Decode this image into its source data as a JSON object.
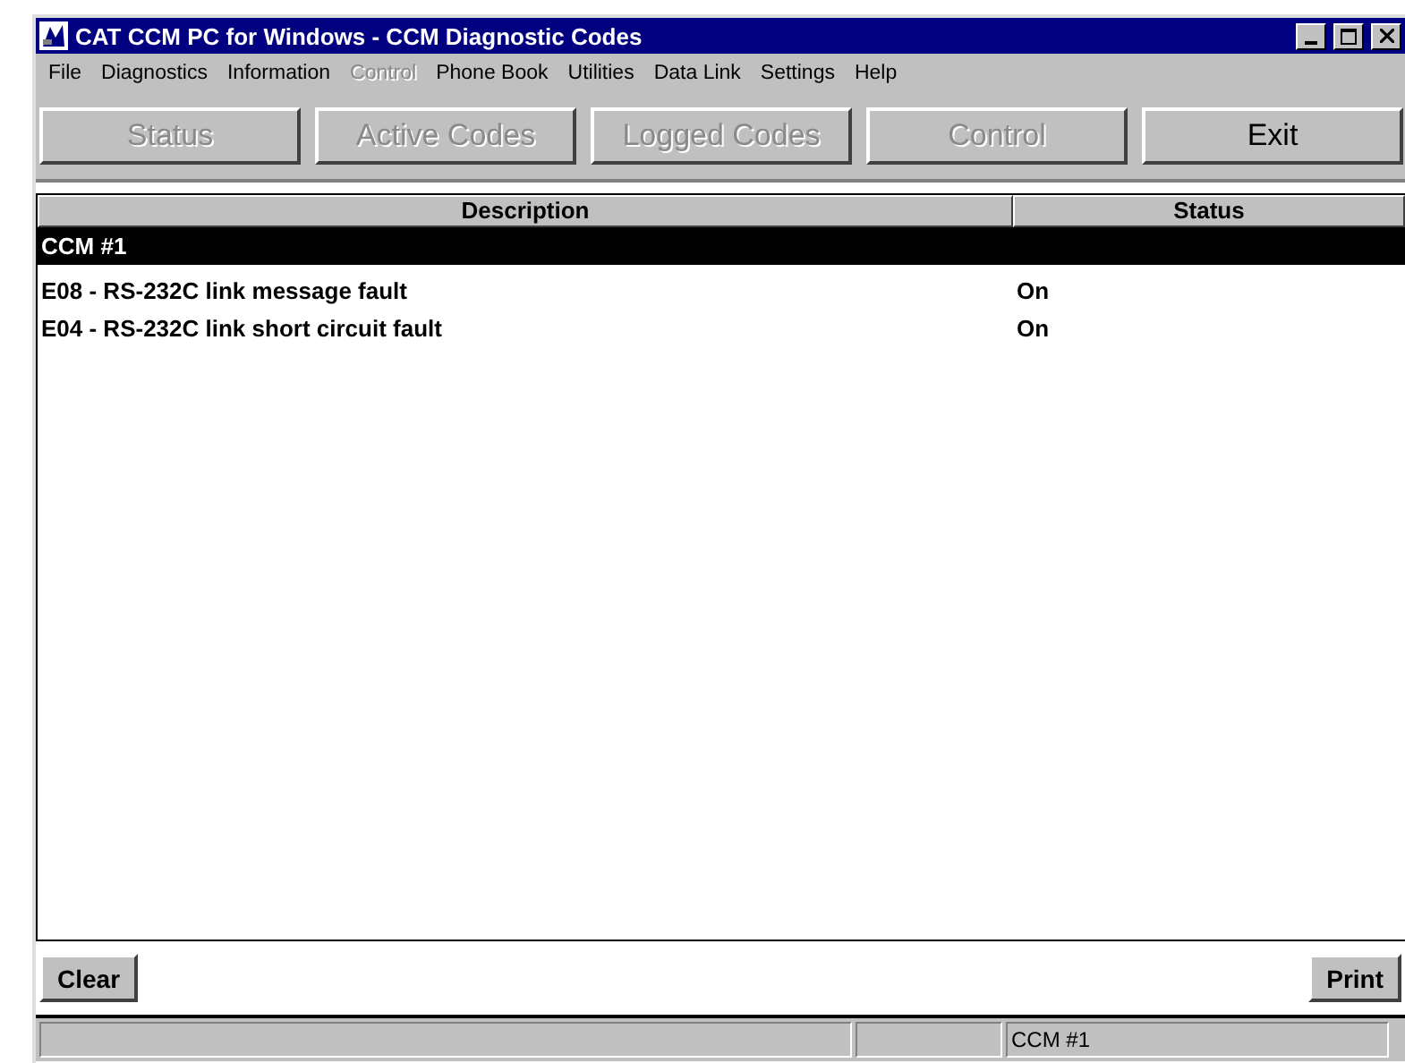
{
  "window": {
    "title": "CAT CCM PC for Windows - CCM Diagnostic Codes"
  },
  "menu": [
    {
      "label": "File",
      "disabled": false
    },
    {
      "label": "Diagnostics",
      "disabled": false
    },
    {
      "label": "Information",
      "disabled": false
    },
    {
      "label": "Control",
      "disabled": true
    },
    {
      "label": "Phone Book",
      "disabled": false
    },
    {
      "label": "Utilities",
      "disabled": false
    },
    {
      "label": "Data Link",
      "disabled": false
    },
    {
      "label": "Settings",
      "disabled": false
    },
    {
      "label": "Help",
      "disabled": false
    }
  ],
  "toolbar": [
    {
      "label": "Status",
      "disabled": true
    },
    {
      "label": "Active Codes",
      "disabled": true
    },
    {
      "label": "Logged Codes",
      "disabled": true
    },
    {
      "label": "Control",
      "disabled": true
    },
    {
      "label": "Exit",
      "disabled": false
    }
  ],
  "table": {
    "columns": [
      "Description",
      "Status"
    ],
    "rows": [
      {
        "description": "CCM #1",
        "selected": true
      },
      {
        "description": "E08 - RS-232C link message fault",
        "status": "On",
        "selected": false
      },
      {
        "description": "E04 - RS-232C link short circuit fault",
        "status": "On",
        "selected": false
      }
    ]
  },
  "buttons": [
    "Clear",
    "Print"
  ],
  "status_bar": {
    "device": "CCM #1"
  }
}
